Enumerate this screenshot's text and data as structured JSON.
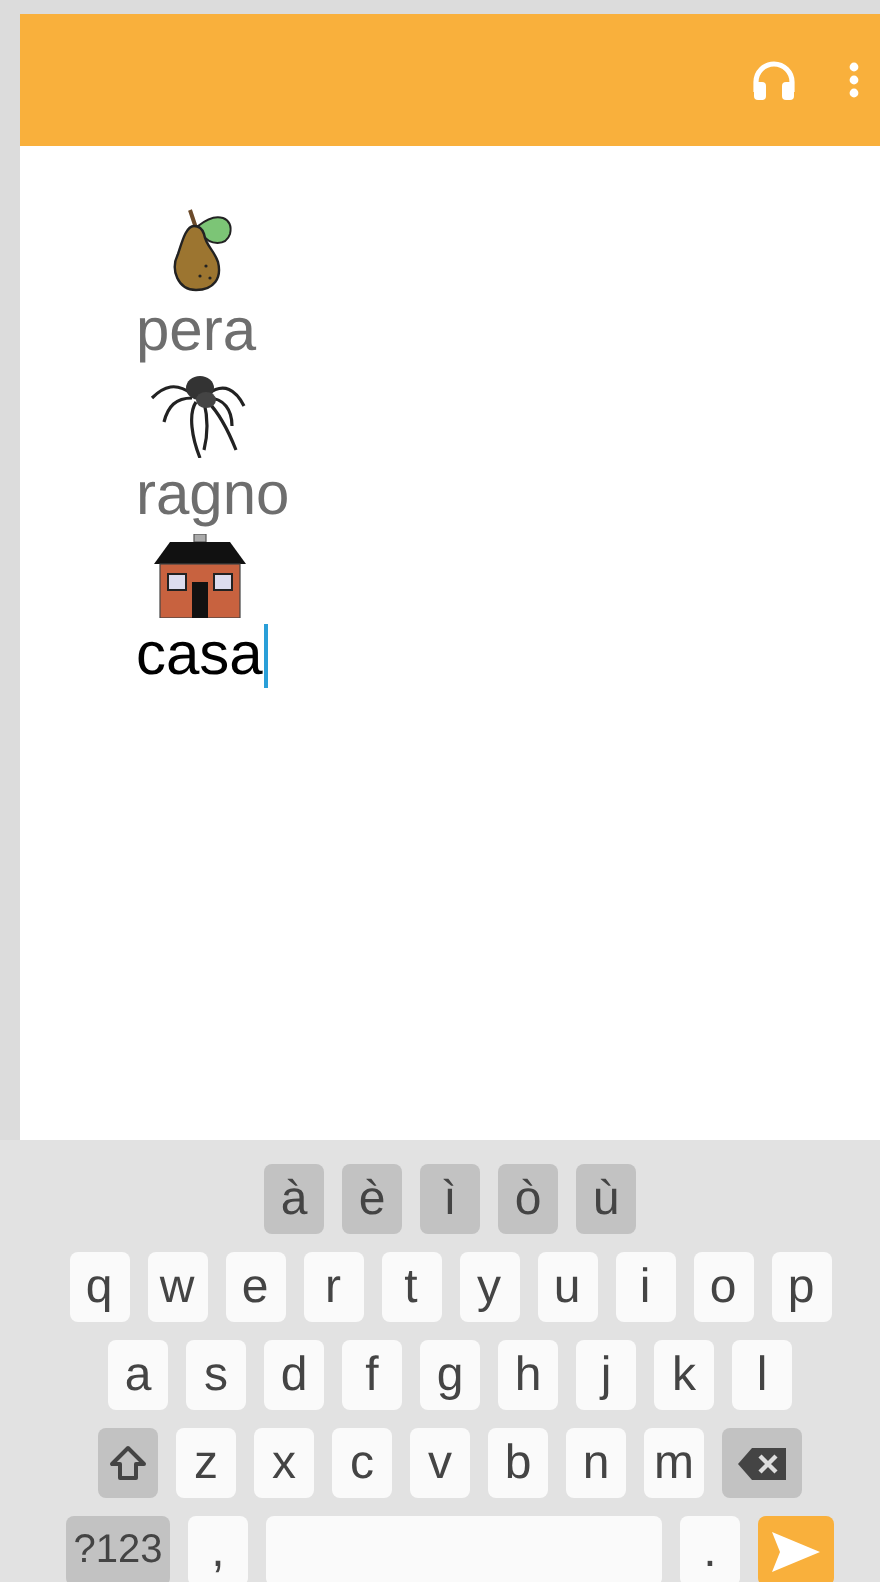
{
  "words": [
    {
      "text": "pera",
      "current": false
    },
    {
      "text": "ragno",
      "current": false
    },
    {
      "text": "casa",
      "current": true
    }
  ],
  "keyboard": {
    "accent_row": [
      {
        "kind": "accent",
        "label": "à"
      },
      {
        "kind": "accent",
        "label": "è"
      },
      {
        "kind": "accent",
        "label": "ì"
      },
      {
        "kind": "accent",
        "label": "ò"
      },
      {
        "kind": "accent",
        "label": "ù"
      }
    ],
    "top_letter_row": [
      {
        "kind": "letter",
        "label": "q"
      },
      {
        "kind": "letter",
        "label": "w"
      },
      {
        "kind": "letter",
        "label": "e"
      },
      {
        "kind": "letter",
        "label": "r"
      },
      {
        "kind": "letter",
        "label": "t"
      },
      {
        "kind": "letter",
        "label": "y"
      },
      {
        "kind": "letter",
        "label": "u"
      },
      {
        "kind": "letter",
        "label": "i"
      },
      {
        "kind": "letter",
        "label": "o"
      },
      {
        "kind": "letter",
        "label": "p"
      }
    ],
    "middle_letter_row": [
      {
        "kind": "letter",
        "label": "a"
      },
      {
        "kind": "letter",
        "label": "s"
      },
      {
        "kind": "letter",
        "label": "d"
      },
      {
        "kind": "letter",
        "label": "f"
      },
      {
        "kind": "letter",
        "label": "g"
      },
      {
        "kind": "letter",
        "label": "h"
      },
      {
        "kind": "letter",
        "label": "j"
      },
      {
        "kind": "letter",
        "label": "k"
      },
      {
        "kind": "letter",
        "label": "l"
      }
    ],
    "bottom_letter_row": [
      {
        "kind": "shift"
      },
      {
        "kind": "letter",
        "label": "z"
      },
      {
        "kind": "letter",
        "label": "x"
      },
      {
        "kind": "letter",
        "label": "c"
      },
      {
        "kind": "letter",
        "label": "v"
      },
      {
        "kind": "letter",
        "label": "b"
      },
      {
        "kind": "letter",
        "label": "n"
      },
      {
        "kind": "letter",
        "label": "m"
      },
      {
        "kind": "backspace"
      }
    ],
    "function_row": [
      {
        "kind": "symbols",
        "label": "?123"
      },
      {
        "kind": "letter",
        "label": ","
      },
      {
        "kind": "space"
      },
      {
        "kind": "letter",
        "label": "."
      },
      {
        "kind": "send"
      }
    ]
  }
}
